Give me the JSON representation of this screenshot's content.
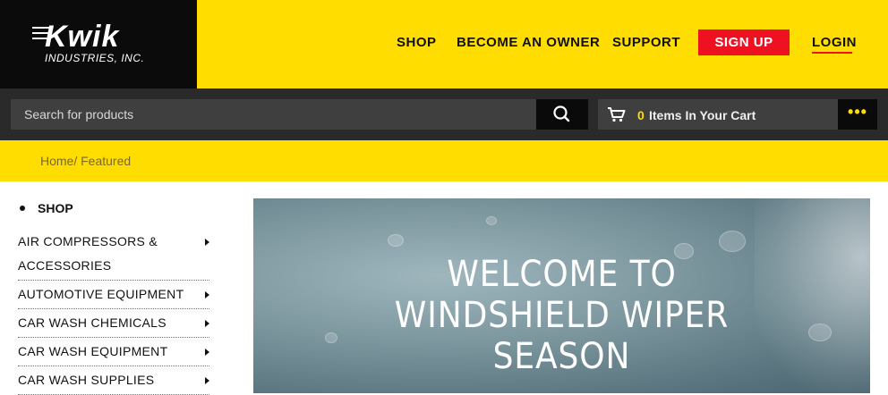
{
  "brand": {
    "name": "Kwik",
    "subtitle": "INDUSTRIES, INC."
  },
  "nav": {
    "shop": "SHOP",
    "become_owner": "BECOME AN OWNER",
    "support": "SUPPORT",
    "signup": "SIGN UP",
    "login": "LOGIN"
  },
  "search": {
    "placeholder": "Search for products"
  },
  "cart": {
    "count": "0",
    "label": "Items In Your Cart"
  },
  "more": "•••",
  "breadcrumb": "Home/ Featured",
  "sidebar": {
    "heading": "SHOP",
    "items": [
      {
        "label": "AIR COMPRESSORS & ACCESSORIES"
      },
      {
        "label": "AUTOMOTIVE EQUIPMENT"
      },
      {
        "label": "CAR WASH CHEMICALS"
      },
      {
        "label": "CAR WASH EQUIPMENT"
      },
      {
        "label": "CAR WASH SUPPLIES"
      }
    ]
  },
  "hero": {
    "line1": "WELCOME TO",
    "line2": "WINDSHIELD WIPER",
    "line3": "SEASON"
  },
  "colors": {
    "brand_yellow": "#ffdd00",
    "signup_red": "#ee1122",
    "dark_bar": "#2a2a2a"
  }
}
